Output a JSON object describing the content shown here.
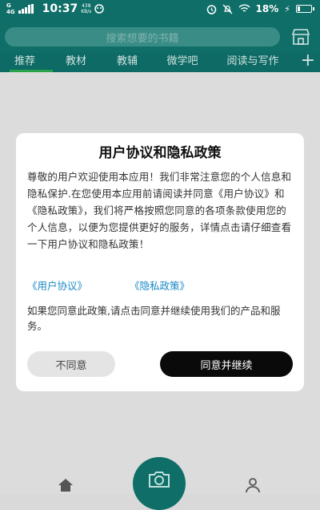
{
  "status_bar": {
    "signal_1": "G",
    "signal_2": "4G",
    "time": "10:37",
    "speed_value": "438",
    "speed_unit": "KB/s",
    "battery_percent": "18%",
    "battery_level": 0.18
  },
  "header": {
    "search_placeholder": "搜索想要的书籍"
  },
  "tabs": [
    {
      "label": "推荐"
    },
    {
      "label": "教材"
    },
    {
      "label": "教辅"
    },
    {
      "label": "微学吧"
    },
    {
      "label": "阅读与写作"
    }
  ],
  "dialog": {
    "title": "用户协议和隐私政策",
    "body": "尊敬的用户欢迎使用本应用！我们非常注意您的个人信息和隐私保护.在您使用本应用前请阅读并同意《用户协议》和《隐私政策》，我们将严格按照您同意的各项条款使用您的个人信息，以便为您提供更好的服务，详情点击请仔细查看一下用户协议和隐私政策！",
    "link_user_agreement": "《用户协议》",
    "link_privacy_policy": "《隐私政策》",
    "note": "如果您同意此政策,请点击同意并继续使用我们的产品和服务。",
    "disagree_label": "不同意",
    "agree_label": "同意并继续"
  },
  "icons": {
    "store": "store-icon",
    "plus": "plus-icon",
    "camera": "camera-icon",
    "home": "home-icon",
    "user": "user-icon"
  },
  "colors": {
    "brand": "#0f6e68",
    "link": "#1a8ac6",
    "tab_indicator": "#2aa24a"
  }
}
